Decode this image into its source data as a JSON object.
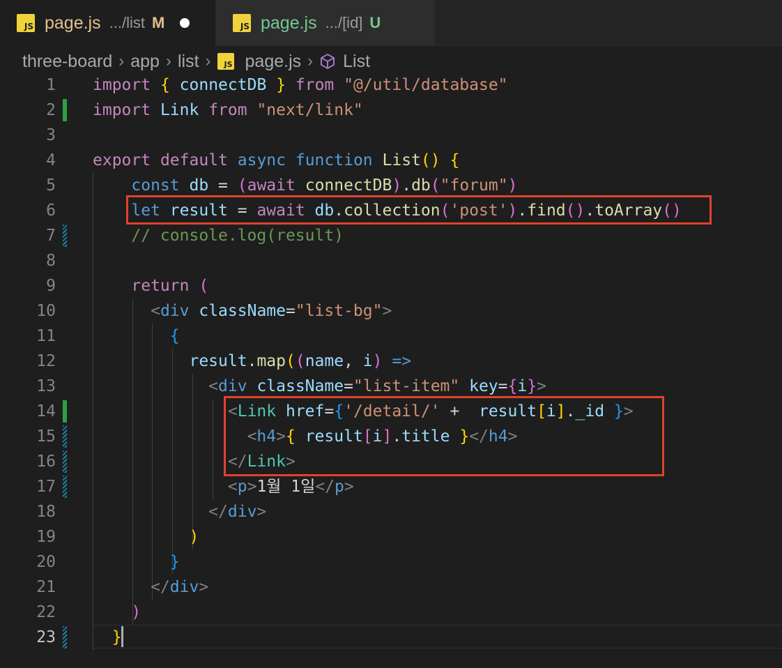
{
  "tabs": [
    {
      "icon": "js-file-icon",
      "badge": "JS",
      "name": "page.js",
      "path": ".../list",
      "status": "M",
      "status_color": "#e2c08d",
      "name_color": "#e2c08d",
      "unsaved": true,
      "active": true
    },
    {
      "icon": "js-file-icon",
      "badge": "JS",
      "name": "page.js",
      "path": ".../[id]",
      "status": "U",
      "status_color": "#73c991",
      "name_color": "#73c991",
      "unsaved": false,
      "active": false
    }
  ],
  "breadcrumb": {
    "items": [
      "three-board",
      "app",
      "list",
      "page.js",
      "List"
    ],
    "file_badge": "JS",
    "symbol_icon": "cube-icon"
  },
  "editor": {
    "current_line": 23,
    "highlight_color": "#e0432c",
    "lines": [
      {
        "n": "1",
        "gutter": "none",
        "tokens": [
          [
            "t-kw",
            "import"
          ],
          [
            "t-op",
            " "
          ],
          [
            "t-b1",
            "{"
          ],
          [
            "t-op",
            " "
          ],
          [
            "t-var",
            "connectDB"
          ],
          [
            "t-op",
            " "
          ],
          [
            "t-b1",
            "}"
          ],
          [
            "t-op",
            " "
          ],
          [
            "t-kw",
            "from"
          ],
          [
            "t-op",
            " "
          ],
          [
            "t-str",
            "\"@/util/database\""
          ]
        ]
      },
      {
        "n": "2",
        "gutter": "added",
        "tokens": [
          [
            "t-kw",
            "import"
          ],
          [
            "t-op",
            " "
          ],
          [
            "t-var",
            "Link"
          ],
          [
            "t-op",
            " "
          ],
          [
            "t-kw",
            "from"
          ],
          [
            "t-op",
            " "
          ],
          [
            "t-str",
            "\"next/link\""
          ]
        ]
      },
      {
        "n": "3",
        "gutter": "none",
        "tokens": []
      },
      {
        "n": "4",
        "gutter": "none",
        "tokens": [
          [
            "t-kw",
            "export"
          ],
          [
            "t-op",
            " "
          ],
          [
            "t-kw",
            "default"
          ],
          [
            "t-op",
            " "
          ],
          [
            "t-st",
            "async"
          ],
          [
            "t-op",
            " "
          ],
          [
            "t-st",
            "function"
          ],
          [
            "t-op",
            " "
          ],
          [
            "t-fn",
            "List"
          ],
          [
            "t-b1",
            "()"
          ],
          [
            "t-op",
            " "
          ],
          [
            "t-b1",
            "{"
          ]
        ]
      },
      {
        "n": "5",
        "gutter": "none",
        "tokens": [
          [
            "t-op",
            "    "
          ],
          [
            "t-st",
            "const"
          ],
          [
            "t-op",
            " "
          ],
          [
            "t-var",
            "db"
          ],
          [
            "t-op",
            " = "
          ],
          [
            "t-b2",
            "("
          ],
          [
            "t-kw",
            "await"
          ],
          [
            "t-op",
            " "
          ],
          [
            "t-fn",
            "connectDB"
          ],
          [
            "t-b2",
            ")"
          ],
          [
            "t-op",
            "."
          ],
          [
            "t-fn",
            "db"
          ],
          [
            "t-b2",
            "("
          ],
          [
            "t-str",
            "\"forum\""
          ],
          [
            "t-b2",
            ")"
          ]
        ]
      },
      {
        "n": "6",
        "gutter": "none",
        "tokens": [
          [
            "t-op",
            "    "
          ],
          [
            "t-st",
            "let"
          ],
          [
            "t-op",
            " "
          ],
          [
            "t-var",
            "result"
          ],
          [
            "t-op",
            " = "
          ],
          [
            "t-kw",
            "await"
          ],
          [
            "t-op",
            " "
          ],
          [
            "t-var",
            "db"
          ],
          [
            "t-op",
            "."
          ],
          [
            "t-fn",
            "collection"
          ],
          [
            "t-b2",
            "("
          ],
          [
            "t-str",
            "'post'"
          ],
          [
            "t-b2",
            ")"
          ],
          [
            "t-op",
            "."
          ],
          [
            "t-fn",
            "find"
          ],
          [
            "t-b2",
            "()"
          ],
          [
            "t-op",
            "."
          ],
          [
            "t-fn",
            "toArray"
          ],
          [
            "t-b2",
            "()"
          ]
        ]
      },
      {
        "n": "7",
        "gutter": "modified",
        "tokens": [
          [
            "t-op",
            "    "
          ],
          [
            "t-com",
            "// console.log(result)"
          ]
        ]
      },
      {
        "n": "8",
        "gutter": "none",
        "tokens": []
      },
      {
        "n": "9",
        "gutter": "none",
        "tokens": [
          [
            "t-op",
            "    "
          ],
          [
            "t-kw",
            "return"
          ],
          [
            "t-op",
            " "
          ],
          [
            "t-b2",
            "("
          ]
        ]
      },
      {
        "n": "10",
        "gutter": "none",
        "tokens": [
          [
            "t-op",
            "      "
          ],
          [
            "t-pun",
            "<"
          ],
          [
            "t-tag",
            "div"
          ],
          [
            "t-op",
            " "
          ],
          [
            "t-var",
            "className"
          ],
          [
            "t-op",
            "="
          ],
          [
            "t-str",
            "\"list-bg\""
          ],
          [
            "t-pun",
            ">"
          ]
        ]
      },
      {
        "n": "11",
        "gutter": "none",
        "tokens": [
          [
            "t-op",
            "        "
          ],
          [
            "t-b3",
            "{"
          ]
        ]
      },
      {
        "n": "12",
        "gutter": "none",
        "tokens": [
          [
            "t-op",
            "          "
          ],
          [
            "t-var",
            "result"
          ],
          [
            "t-op",
            "."
          ],
          [
            "t-fn",
            "map"
          ],
          [
            "t-b1",
            "("
          ],
          [
            "t-b2",
            "("
          ],
          [
            "t-var",
            "name"
          ],
          [
            "t-op",
            ", "
          ],
          [
            "t-var",
            "i"
          ],
          [
            "t-b2",
            ")"
          ],
          [
            "t-op",
            " "
          ],
          [
            "t-st",
            "=>"
          ]
        ]
      },
      {
        "n": "13",
        "gutter": "none",
        "tokens": [
          [
            "t-op",
            "            "
          ],
          [
            "t-pun",
            "<"
          ],
          [
            "t-tag",
            "div"
          ],
          [
            "t-op",
            " "
          ],
          [
            "t-var",
            "className"
          ],
          [
            "t-op",
            "="
          ],
          [
            "t-str",
            "\"list-item\""
          ],
          [
            "t-op",
            " "
          ],
          [
            "t-var",
            "key"
          ],
          [
            "t-op",
            "="
          ],
          [
            "t-b2",
            "{"
          ],
          [
            "t-var",
            "i"
          ],
          [
            "t-b2",
            "}"
          ],
          [
            "t-pun",
            ">"
          ]
        ]
      },
      {
        "n": "14",
        "gutter": "added",
        "tokens": [
          [
            "t-op",
            "              "
          ],
          [
            "t-pun",
            "<"
          ],
          [
            "t-comp",
            "Link"
          ],
          [
            "t-op",
            " "
          ],
          [
            "t-var",
            "href"
          ],
          [
            "t-op",
            "="
          ],
          [
            "t-b3",
            "{"
          ],
          [
            "t-str",
            "'/detail/'"
          ],
          [
            "t-op",
            " +  "
          ],
          [
            "t-var",
            "result"
          ],
          [
            "t-b1",
            "["
          ],
          [
            "t-var",
            "i"
          ],
          [
            "t-b1",
            "]"
          ],
          [
            "t-op",
            "."
          ],
          [
            "t-var",
            "_id"
          ],
          [
            "t-op",
            " "
          ],
          [
            "t-b3",
            "}"
          ],
          [
            "t-pun",
            ">"
          ]
        ]
      },
      {
        "n": "15",
        "gutter": "modified",
        "tokens": [
          [
            "t-op",
            "                "
          ],
          [
            "t-pun",
            "<"
          ],
          [
            "t-tag",
            "h4"
          ],
          [
            "t-pun",
            ">"
          ],
          [
            "t-b1",
            "{"
          ],
          [
            "t-op",
            " "
          ],
          [
            "t-var",
            "result"
          ],
          [
            "t-b2",
            "["
          ],
          [
            "t-var",
            "i"
          ],
          [
            "t-b2",
            "]"
          ],
          [
            "t-op",
            "."
          ],
          [
            "t-var",
            "title"
          ],
          [
            "t-op",
            " "
          ],
          [
            "t-b1",
            "}"
          ],
          [
            "t-pun",
            "</"
          ],
          [
            "t-tag",
            "h4"
          ],
          [
            "t-pun",
            ">"
          ]
        ]
      },
      {
        "n": "16",
        "gutter": "modified",
        "tokens": [
          [
            "t-op",
            "              "
          ],
          [
            "t-pun",
            "</"
          ],
          [
            "t-comp",
            "Link"
          ],
          [
            "t-pun",
            ">"
          ]
        ]
      },
      {
        "n": "17",
        "gutter": "modified",
        "tokens": [
          [
            "t-op",
            "              "
          ],
          [
            "t-pun",
            "<"
          ],
          [
            "t-tag",
            "p"
          ],
          [
            "t-pun",
            ">"
          ],
          [
            "t-txt",
            "1월 1일"
          ],
          [
            "t-pun",
            "</"
          ],
          [
            "t-tag",
            "p"
          ],
          [
            "t-pun",
            ">"
          ]
        ]
      },
      {
        "n": "18",
        "gutter": "none",
        "tokens": [
          [
            "t-op",
            "            "
          ],
          [
            "t-pun",
            "</"
          ],
          [
            "t-tag",
            "div"
          ],
          [
            "t-pun",
            ">"
          ]
        ]
      },
      {
        "n": "19",
        "gutter": "none",
        "tokens": [
          [
            "t-op",
            "          "
          ],
          [
            "t-b1",
            ")"
          ]
        ]
      },
      {
        "n": "20",
        "gutter": "none",
        "tokens": [
          [
            "t-op",
            "        "
          ],
          [
            "t-b3",
            "}"
          ]
        ]
      },
      {
        "n": "21",
        "gutter": "none",
        "tokens": [
          [
            "t-op",
            "      "
          ],
          [
            "t-pun",
            "</"
          ],
          [
            "t-tag",
            "div"
          ],
          [
            "t-pun",
            ">"
          ]
        ]
      },
      {
        "n": "22",
        "gutter": "none",
        "tokens": [
          [
            "t-op",
            "    "
          ],
          [
            "t-b2",
            ")"
          ]
        ]
      },
      {
        "n": "23",
        "gutter": "modified",
        "tokens": [
          [
            "t-op",
            "  "
          ],
          [
            "t-b1",
            "}"
          ]
        ]
      }
    ]
  }
}
